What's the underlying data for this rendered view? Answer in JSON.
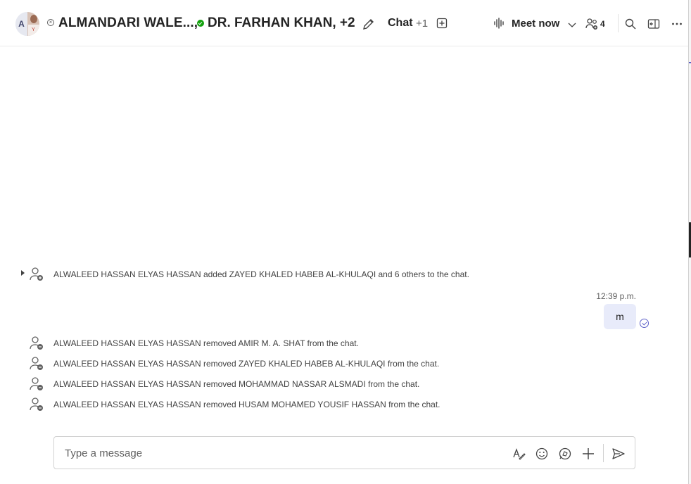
{
  "header": {
    "avatar_initial": "A",
    "avatar_sub": "Y",
    "title_part1": "ALMANDARI WALE...,",
    "title_part2": "DR. FARHAN KHAN, +2",
    "tabs": [
      {
        "label": "Chat"
      }
    ],
    "tabs_more": "+1",
    "meet_now_label": "Meet now",
    "participants_count": "4",
    "icons": [
      "pencil-icon",
      "add-tab-icon",
      "audio-wave-icon",
      "chevron-down-icon",
      "people-icon",
      "search-icon",
      "popout-icon",
      "more-icon"
    ]
  },
  "messages": {
    "system_added": "ALWALEED HASSAN ELYAS HASSAN added ZAYED KHALED HABEB AL-KHULAQI and 6 others to the chat.",
    "own_message": {
      "time": "12:39 p.m.",
      "text": "m"
    },
    "system_removed": [
      "ALWALEED HASSAN ELYAS HASSAN removed AMIR M. A. SHAT from the chat.",
      "ALWALEED HASSAN ELYAS HASSAN removed ZAYED KHALED HABEB AL-KHULAQI from the chat.",
      "ALWALEED HASSAN ELYAS HASSAN removed MOHAMMAD NASSAR ALSMADI from the chat.",
      "ALWALEED HASSAN ELYAS HASSAN removed HUSAM MOHAMED YOUSIF HASSAN from the chat."
    ]
  },
  "compose": {
    "placeholder": "Type a message",
    "icons": [
      "format-icon",
      "emoji-icon",
      "loop-icon",
      "attach-plus-icon",
      "send-icon"
    ]
  },
  "colors": {
    "accent": "#5b5fc7",
    "bubble": "#e8ebfa",
    "presence_available": "#13a10e"
  }
}
